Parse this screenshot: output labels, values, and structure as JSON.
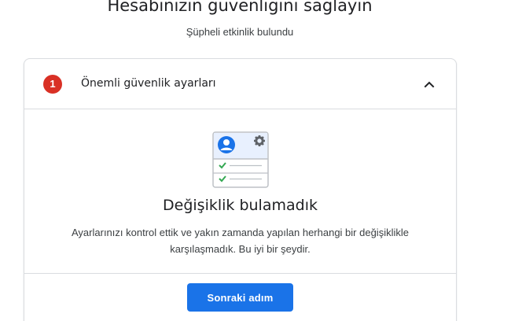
{
  "header": {
    "title": "Hesabınızın güvenliğini sağlayın",
    "subtitle": "Şüpheli etkinlik bulundu"
  },
  "card": {
    "badge_count": "1",
    "section_label": "Önemli güvenlik ayarları",
    "expanded_icon": "chevron-up-icon",
    "illustration_icon": "account-settings-checklist-icon",
    "result_title": "Değişiklik bulamadık",
    "result_description": "Ayarlarınızı kontrol ettik ve yakın zamanda yapılan herhangi bir değişiklikle karşılaşmadık. Bu iyi bir şeydir.",
    "next_button_label": "Sonraki adım"
  },
  "colors": {
    "accent": "#1a73e8",
    "badge": "#d93025",
    "check": "#34a853",
    "border": "#dadce0"
  }
}
